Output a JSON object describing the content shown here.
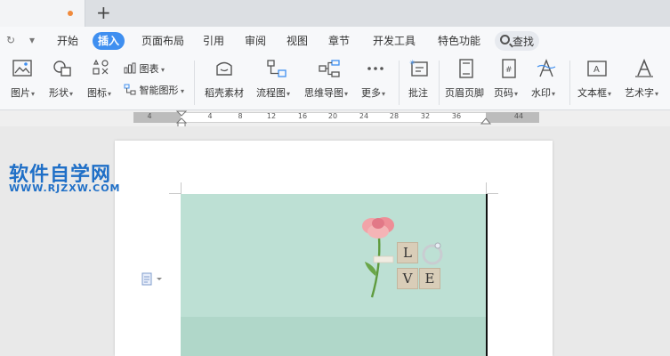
{
  "titlebar": {
    "new_tab_symbol": "+"
  },
  "menubar": {
    "redo_symbol": "↻",
    "more_symbol": "▾",
    "items": [
      "开始",
      "插入",
      "页面布局",
      "引用",
      "审阅",
      "视图",
      "章节",
      "开发工具",
      "特色功能"
    ],
    "active_item": "插入",
    "search_label": "查找"
  },
  "ribbon": {
    "picture": "图片",
    "shape": "形状",
    "icon": "图标",
    "chart": "图表",
    "smartart": "智能图形",
    "docer": "稻壳素材",
    "flowchart": "流程图",
    "mindmap": "思维导图",
    "more": "更多",
    "comment": "批注",
    "header_footer": "页眉页脚",
    "page_number": "页码",
    "watermark": "水印",
    "textbox": "文本框",
    "wordart": "艺术字"
  },
  "ruler": {
    "ticks": [
      "4",
      "4",
      "8",
      "12",
      "16",
      "20",
      "24",
      "28",
      "32",
      "36",
      "44"
    ]
  },
  "watermark_logo": {
    "title": "软件自学网",
    "url": "WWW.RJZXW.COM"
  },
  "love_image": {
    "letters": [
      "L",
      "V",
      "E"
    ]
  },
  "colors": {
    "accent": "#3f8ff0",
    "cover": "#bde0d4",
    "logo": "#1f6fc7"
  }
}
